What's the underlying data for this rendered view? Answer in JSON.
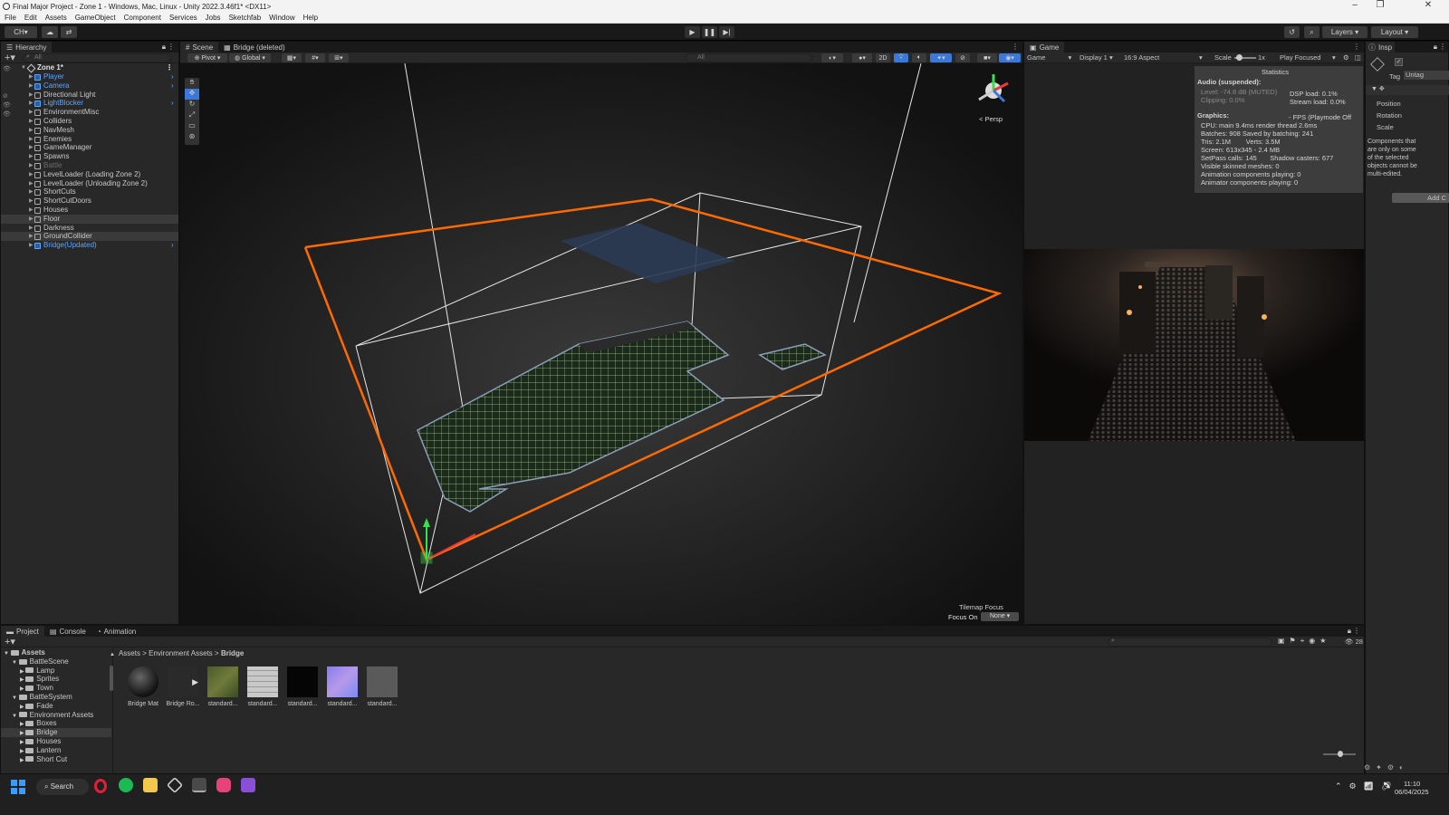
{
  "window": {
    "title": "Final Major Project - Zone 1 - Windows, Mac, Linux - Unity 2022.3.46f1* <DX11>"
  },
  "menu": [
    "File",
    "Edit",
    "Assets",
    "GameObject",
    "Component",
    "Services",
    "Jobs",
    "Sketchfab",
    "Window",
    "Help"
  ],
  "toolbar": {
    "account": "CH",
    "layers": "Layers",
    "layout": "Layout"
  },
  "hierarchy": {
    "tab": "Hierarchy",
    "search_placeholder": "All",
    "scene": "Zone 1*",
    "items": [
      {
        "label": "Player",
        "style": "blue"
      },
      {
        "label": "Camera",
        "style": "blue"
      },
      {
        "label": "Directional Light",
        "style": "normal"
      },
      {
        "label": "LightBlocker",
        "style": "blue"
      },
      {
        "label": "EnvironmentMisc",
        "style": "normal"
      },
      {
        "label": "Colliders",
        "style": "normal"
      },
      {
        "label": "NavMesh",
        "style": "normal"
      },
      {
        "label": "Enemies",
        "style": "normal"
      },
      {
        "label": "GameManager",
        "style": "normal"
      },
      {
        "label": "Spawns",
        "style": "normal"
      },
      {
        "label": "Battle",
        "style": "dim"
      },
      {
        "label": "LevelLoader (Loading Zone 2)",
        "style": "normal"
      },
      {
        "label": "LevelLoader (Unloading Zone 2)",
        "style": "normal"
      },
      {
        "label": "ShortCuts",
        "style": "normal"
      },
      {
        "label": "ShortCutDoors",
        "style": "normal"
      },
      {
        "label": "Houses",
        "style": "normal"
      },
      {
        "label": "Floor",
        "style": "sel"
      },
      {
        "label": "Darkness",
        "style": "normal"
      },
      {
        "label": "GroundCollider",
        "style": "sel"
      },
      {
        "label": "Bridge(Updated)",
        "style": "blue"
      }
    ]
  },
  "scene": {
    "tabs": [
      "Scene",
      "Bridge (deleted)"
    ],
    "pivot": "Pivot",
    "global": "Global",
    "search_placeholder": "All",
    "mode2d": "2D",
    "persp": "< Persp",
    "tilemap_focus": "Tilemap Focus",
    "focus_on": "Focus On",
    "focus_value": "None"
  },
  "game": {
    "tab": "Game",
    "view": "Game",
    "display": "Display 1",
    "aspect": "16:9 Aspect",
    "scale_label": "Scale",
    "scale_value": "1x",
    "play_mode": "Play Focused"
  },
  "stats": {
    "title": "Statistics",
    "audio": "Audio (suspended):",
    "level": "Level: -74.8 dB (MUTED)",
    "clipping": "Clipping: 0.0%",
    "dsp": "DSP load: 0.1%",
    "stream": "Stream load: 0.0%",
    "graphics": "Graphics:",
    "fps": "- FPS (Playmode Off",
    "cpu": "CPU: main 9.4ms  render thread 2.6ms",
    "batches": "Batches: 908   Saved by batching: 241",
    "tris": "Tris: 2.1M        Verts: 3.5M",
    "screen": "Screen: 613x345 - 2.4 MB",
    "setpass": "SetPass calls: 145       Shadow casters: 677",
    "skinned": "Visible skinned meshes: 0",
    "anim": "Animation components playing: 0",
    "animator": "Animator components playing: 0"
  },
  "inspector": {
    "tab": "Insp",
    "tag_label": "Tag",
    "tag_value": "Untag",
    "position": "Position",
    "rotation": "Rotation",
    "scale": "Scale",
    "note": "Components that are only on some of the selected objects cannot be multi-edited.",
    "add_button": "Add C"
  },
  "project": {
    "tabs": [
      "Project",
      "Console",
      "Animation"
    ],
    "tree": [
      {
        "label": "Assets",
        "depth": 0,
        "bold": true
      },
      {
        "label": "BattleScene",
        "depth": 1
      },
      {
        "label": "Lamp",
        "depth": 2
      },
      {
        "label": "Sprites",
        "depth": 2
      },
      {
        "label": "Town",
        "depth": 2
      },
      {
        "label": "BattleSystem",
        "depth": 1
      },
      {
        "label": "Fade",
        "depth": 2
      },
      {
        "label": "Environment Assets",
        "depth": 1
      },
      {
        "label": "Boxes",
        "depth": 2
      },
      {
        "label": "Bridge",
        "depth": 2,
        "selected": true
      },
      {
        "label": "Houses",
        "depth": 2
      },
      {
        "label": "Lantern",
        "depth": 2
      },
      {
        "label": "Short Cut",
        "depth": 2
      }
    ],
    "breadcrumb": [
      "Assets",
      "Environment Assets",
      "Bridge"
    ],
    "count": "28",
    "assets": [
      {
        "label": "Bridge Mat",
        "kind": "sphere"
      },
      {
        "label": "Bridge Ro...",
        "kind": "anim"
      },
      {
        "label": "standard...",
        "kind": "moss"
      },
      {
        "label": "standard...",
        "kind": "stone"
      },
      {
        "label": "standard...",
        "kind": "black"
      },
      {
        "label": "standard...",
        "kind": "normal"
      },
      {
        "label": "standard...",
        "kind": "gray"
      }
    ]
  },
  "taskbar": {
    "search": "Search",
    "time": "11:10",
    "date": "06/04/2025"
  },
  "colors": {
    "selection_orange": "#ff6a00",
    "blue_text": "#5da6ff",
    "accent_blue": "#3a79d9"
  }
}
